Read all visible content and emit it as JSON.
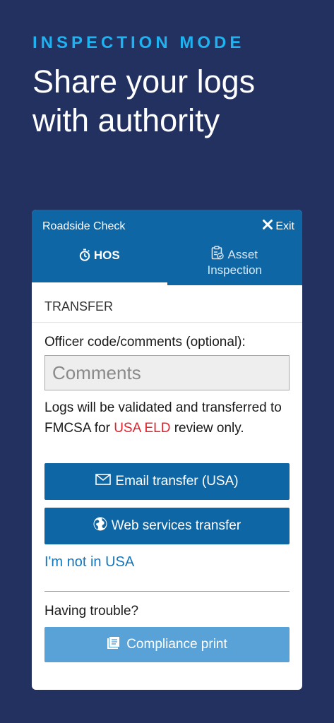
{
  "hero": {
    "eyebrow": "INSPECTION MODE",
    "title": "Share your logs with authority"
  },
  "app": {
    "header_title": "Roadside Check",
    "exit_label": "Exit",
    "tabs": [
      {
        "label": "HOS",
        "icon": "stopwatch-icon",
        "active": true
      },
      {
        "label_line1": "Asset",
        "label_line2": "Inspection",
        "icon": "clipboard-check-icon",
        "active": false
      }
    ]
  },
  "transfer": {
    "section_title": "TRANSFER",
    "comments_label": "Officer code/comments (optional):",
    "comments_placeholder": "Comments",
    "comments_value": "",
    "notice_pre": "Logs will be validated and transferred to FMCSA for ",
    "notice_highlight": "USA ELD",
    "notice_post": " review only.",
    "email_button": "Email transfer (USA)",
    "web_button": "Web services transfer",
    "not_usa_link": "I'm not in USA",
    "trouble_label": "Having trouble?",
    "print_button": "Compliance print"
  },
  "colors": {
    "background": "#223160",
    "accent": "#1eb2f0",
    "primary": "#0f66a5",
    "primary_light": "#58a2d8",
    "highlight_red": "#e3202b"
  }
}
